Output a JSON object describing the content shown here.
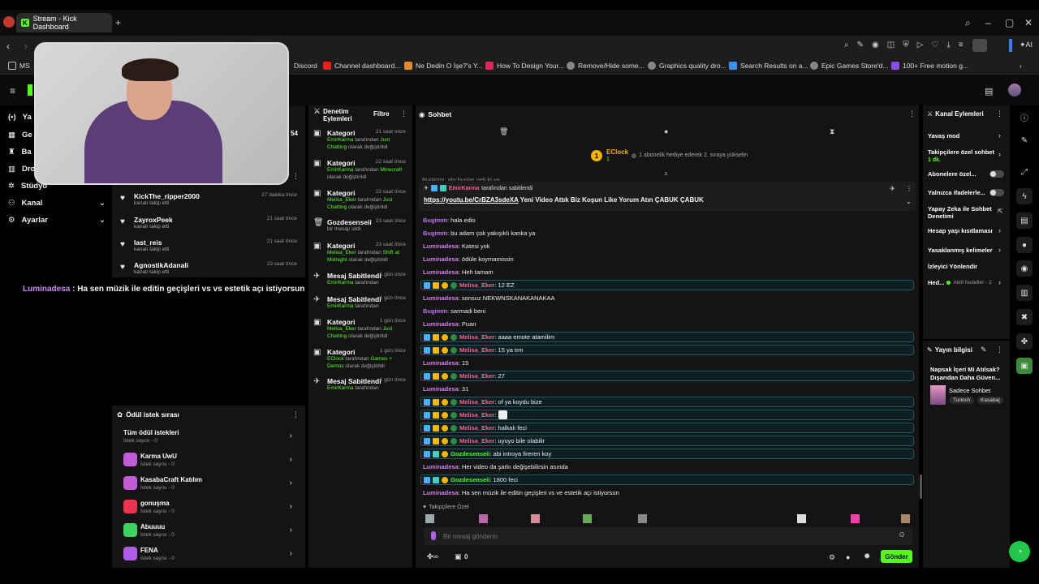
{
  "browser": {
    "tab_title": "Stream - Kick Dashboard",
    "bookmarks": [
      "MS",
      "Discord",
      "Channel dashboard...",
      "Ne Dedin O İşe?'s Y...",
      "How To Design Your...",
      "Remove/Hide some...",
      "Graphics quality dro...",
      "Search Results on a...",
      "Epic Games Store'd...",
      "100+ Free motion g..."
    ]
  },
  "sidebar": {
    "items": [
      {
        "label": "Ya"
      },
      {
        "label": "Ge"
      },
      {
        "label": "Ba"
      },
      {
        "label": "Dro"
      },
      {
        "label": "Stüdyo"
      },
      {
        "label": "Kanal"
      },
      {
        "label": "Ayarlar"
      }
    ]
  },
  "stream_clock": "54",
  "activity_feed": [
    {
      "name": "KickThe_ripper2000",
      "action": "kanalı takip etti",
      "time": "27 dakika önce"
    },
    {
      "name": "ZayroxPeek",
      "action": "kanalı takip etti",
      "time": "21 saat önce"
    },
    {
      "name": "last_reis",
      "action": "kanalı takip etti",
      "time": "21 saat önce"
    },
    {
      "name": "AgnostikAdanali",
      "action": "kanalı takip etti",
      "time": "23 saat önce"
    }
  ],
  "overlay_message": {
    "user": "Luminadesa",
    "sep": " : ",
    "text": "Ha sen müzik ile editin geçişleri vs vs estetik açı istiyorsun"
  },
  "rewards": {
    "title": "Ödül istek sırası",
    "items": [
      {
        "name": "Tüm ödül istekleri",
        "sub": "İstek sayısı - 0",
        "color": ""
      },
      {
        "name": "Karma UwU",
        "sub": "İstek sayısı - 0",
        "color": "#c15bd6"
      },
      {
        "name": "KasabaCraft Katılım",
        "sub": "İstek sayısı - 0",
        "color": "#c15bd6"
      },
      {
        "name": "gonuşma",
        "sub": "İstek sayısı - 0",
        "color": "#e8344e"
      },
      {
        "name": "Abuuuu",
        "sub": "İstek sayısı - 0",
        "color": "#3fd15e"
      },
      {
        "name": "FENA",
        "sub": "İstek sayısı - 0",
        "color": "#b05ce8"
      }
    ]
  },
  "mod_actions": {
    "title_line1": "Denetim",
    "title_line2": "Eylemleri",
    "filter": "Filtre",
    "items": [
      {
        "type": "Kategori",
        "time": "21 saat önce",
        "actor": "EmirKarma",
        "l1": " tarafından ",
        "val": "Just Chatting",
        "l2": " olarak değiştirildi"
      },
      {
        "type": "Kategori",
        "time": "22 saat önce",
        "actor": "EmirKarma",
        "l1": " tarafından ",
        "val": "Minecraft",
        "l2": " olarak değiştirildi"
      },
      {
        "type": "Kategori",
        "time": "22 saat önce",
        "actor": "Melisa_Eker",
        "l1": " tarafından ",
        "val": "Just Chatting",
        "l2": " olarak değiştirildi"
      },
      {
        "type": "Gozdesenseii",
        "time": "23 saat önce",
        "actor": "",
        "l1": "bir mesajı sildi",
        "val": "",
        "l2": ""
      },
      {
        "type": "Kategori",
        "time": "23 saat önce",
        "actor": "Melisa_Eker",
        "l1": " tarafından ",
        "val": "Shift at Midnight",
        "l2": " olarak değiştirildi"
      },
      {
        "type": "Mesaj Sabitlendi",
        "time": "1 gün önce",
        "actor": "EmirKarma",
        "l1": " tarafından",
        "val": "",
        "l2": ""
      },
      {
        "type": "Mesaj Sabitlendi",
        "time": "1 gün önce",
        "actor": "EmirKarma",
        "l1": " tarafından",
        "val": "",
        "l2": ""
      },
      {
        "type": "Kategori",
        "time": "1 gün önce",
        "actor": "Melisa_Eker",
        "l1": " tarafından ",
        "val": "Just Chatting",
        "l2": " olarak değiştirildi"
      },
      {
        "type": "Kategori",
        "time": "1 gün önce",
        "actor": "EClock",
        "l1": " tarafından ",
        "val": "Games + Demos",
        "l2": " olarak değiştirildi"
      },
      {
        "type": "Mesaj Sabitlendi",
        "time": "1 gün önce",
        "actor": "EmirKarma",
        "l1": " tarafından",
        "val": "",
        "l2": ""
      }
    ]
  },
  "chat": {
    "title": "Sohbet",
    "leader": {
      "rank": "1",
      "name": "EClock",
      "count": "1",
      "text": "1 abonelik hediye ederek 2. sıraya yükselin"
    },
    "pinned": {
      "by": "EmirKarma",
      "by_suffix": " tarafından sabitlendi",
      "url": "https://youtu.be/CrBZA3sdeXA",
      "text": " Yeni Video Attık Biz Koşun Like Yorum Atın ÇABUK ÇABUK"
    },
    "partial_line": "Bugimm: alo bunlar neli ki ya",
    "messages": [
      {
        "user": "Bugimm",
        "text": ": hala edio",
        "style": "b",
        "hl": false
      },
      {
        "user": "Bugimm",
        "text": ": bu adam çok yakışıklı kanka ya",
        "style": "b",
        "hl": false
      },
      {
        "user": "Luminadesa",
        "text": ": Katesi yok",
        "style": "l",
        "hl": false
      },
      {
        "user": "Luminadesa",
        "text": ": ödüle koymamissin",
        "style": "l",
        "hl": false
      },
      {
        "user": "Luminadesa",
        "text": ": Heh tamam",
        "style": "l",
        "hl": false
      },
      {
        "user": "Melisa_Eker",
        "text": ": 12 EZ",
        "style": "m",
        "hl": true
      },
      {
        "user": "Luminadesa",
        "text": ": sonsuz NEKWNSKANAKANAKAA",
        "style": "l",
        "hl": false
      },
      {
        "user": "Bugimm",
        "text": ": sarmadi beni",
        "style": "b",
        "hl": false
      },
      {
        "user": "Luminadesa",
        "text": ": Puan",
        "style": "l",
        "hl": false
      },
      {
        "user": "Melisa_Eker",
        "text": ": aaaa emote atamilim",
        "style": "m",
        "hl": true
      },
      {
        "user": "Melisa_Eker",
        "text": ": 15 ya tım",
        "style": "m",
        "hl": true
      },
      {
        "user": "Luminadesa",
        "text": ": 15",
        "style": "l",
        "hl": false
      },
      {
        "user": "Melisa_Eker",
        "text": ": 27",
        "style": "m",
        "hl": true
      },
      {
        "user": "Luminadesa",
        "text": ": 31",
        "style": "l",
        "hl": false
      },
      {
        "user": "Melisa_Eker",
        "text": ": of ya koydu bize",
        "style": "m",
        "hl": true
      },
      {
        "user": "Melisa_Eker",
        "text": ":",
        "style": "m",
        "hl": true,
        "emote": true
      },
      {
        "user": "Melisa_Eker",
        "text": ": halkalı feci",
        "style": "m",
        "hl": true
      },
      {
        "user": "Melisa_Eker",
        "text": ": uyuyo bile olabilir",
        "style": "m",
        "hl": true
      },
      {
        "user": "Gozdesenseii",
        "text": ": abi introya fireren koy",
        "style": "g",
        "hl": true
      },
      {
        "user": "Luminadesa",
        "text": ": Her video da şarkı değişebilirsin asında",
        "style": "l",
        "hl": false
      },
      {
        "user": "Gozdesenseii",
        "text": ": 1800 feci",
        "style": "g",
        "hl": true
      },
      {
        "user": "Luminadesa",
        "text": ": Ha sen müzik ile editin geçişleri vs ve estetik açı istiyorsun",
        "style": "l",
        "hl": false
      }
    ],
    "followers_only": "Takipçilere Özel",
    "input_placeholder": "Bir mesaj gönderin",
    "points": "0",
    "send": "Gönder"
  },
  "channel_actions": {
    "title": "Kanal Eylemleri",
    "items": [
      {
        "label": "Yavaş mod",
        "sub": ""
      },
      {
        "label": "Takipçilere özel sohbet",
        "sub": "1 dk."
      },
      {
        "label": "Abonelere özel...",
        "sub": ""
      },
      {
        "label": "Yalnızca ifadelerle...",
        "sub": ""
      },
      {
        "label": "Yapay Zeka ile Sohbet Denetimi",
        "sub": ""
      },
      {
        "label": "Hesap yaşı kısıtlaması",
        "sub": ""
      },
      {
        "label": "Yasaklanmış kelimeler",
        "sub": ""
      },
      {
        "label": "İzleyici Yönlendir",
        "sub": ""
      },
      {
        "label": "Hed...",
        "sub": "Aktif hedefler - 2"
      }
    ]
  },
  "stream_info": {
    "title": "Yayın bilgisi",
    "stream_title": "Napsak İçeri Mi Atılsak? Dışarıdan Daha Güven...",
    "category": "Sadece Sohbet",
    "tags": [
      "Turkish",
      "Kasaba("
    ]
  },
  "colors": {
    "accent": "#53fc18",
    "panel": "#141414",
    "highlight_border": "#1e5b64"
  }
}
